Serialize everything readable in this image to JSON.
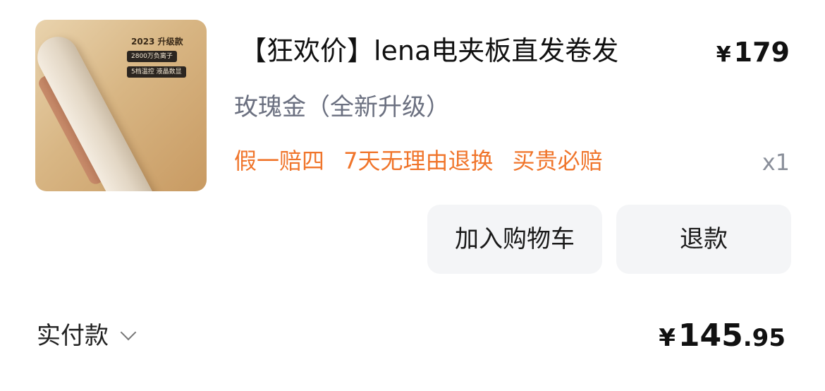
{
  "product": {
    "image_texts": {
      "year_badge": "2023 升级款",
      "feature_1": "2800万负离子",
      "feature_2": "5档温控 液晶数显"
    },
    "title": "【狂欢价】lena电夹板直发卷发",
    "price_symbol": "¥",
    "price": "179",
    "spec": "玫瑰金（全新升级）",
    "promos": [
      "假一赔四",
      "7天无理由退换",
      "买贵必赔"
    ],
    "quantity": "x1"
  },
  "actions": {
    "add_to_cart": "加入购物车",
    "refund": "退款"
  },
  "payment": {
    "label": "实付款",
    "currency": "¥",
    "amount_integer": "145",
    "amount_decimal": ".95"
  },
  "colors": {
    "promo": "#f0752b",
    "spec": "#6b7080",
    "button_bg": "#f4f5f7"
  }
}
